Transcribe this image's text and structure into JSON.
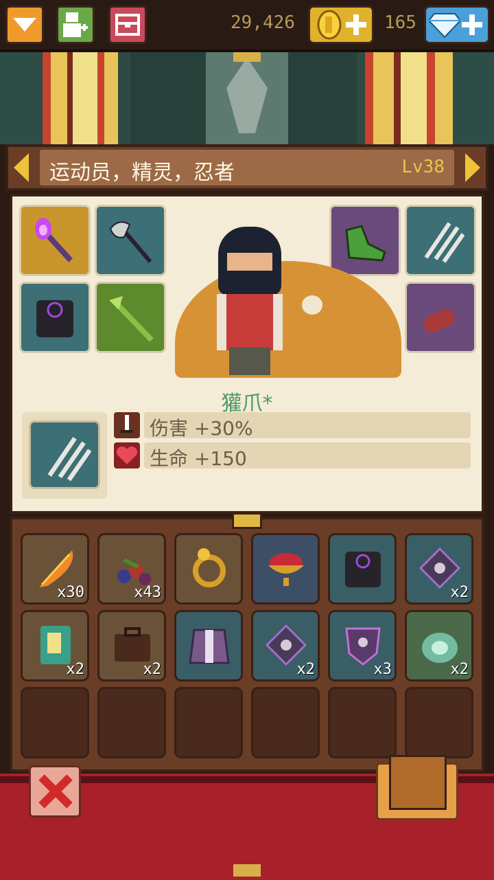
{
  "topbar": {
    "gold": "29,426",
    "gems": "165",
    "icons": [
      "dropdown-icon",
      "add-hero-icon",
      "chest-menu-icon",
      "coin-icon",
      "diamond-icon"
    ]
  },
  "character": {
    "title": "运动员，精灵，忍者",
    "level": "Lv38"
  },
  "selected_item": {
    "name": "獾爪*",
    "stats": [
      {
        "icon": "sword-icon",
        "text": "伤害  +30%",
        "color": "#6a3020"
      },
      {
        "icon": "heart-icon",
        "text": "生命  +150",
        "color": "#8a2020"
      }
    ]
  },
  "equipment": [
    {
      "name": "purple-torch-icon",
      "color": "#c8962c"
    },
    {
      "name": "battle-axe-icon",
      "color": "#3c6f76"
    },
    {
      "name": "dark-armor-icon",
      "color": "#3c6f76"
    },
    {
      "name": "bamboo-staff-icon",
      "color": "#5c8a2c"
    },
    {
      "name": "green-boots-icon",
      "color": "#6a4a7a"
    },
    {
      "name": "claw-icon",
      "color": "#3c6f76"
    },
    {
      "name": "scroll-icon",
      "color": "#6a4a7a"
    }
  ],
  "inventory": [
    {
      "icon": "feather-icon",
      "count": "x30"
    },
    {
      "icon": "berries-icon",
      "count": "x43"
    },
    {
      "icon": "gold-ring-icon",
      "count": ""
    },
    {
      "icon": "ruby-bowl-icon",
      "count": ""
    },
    {
      "icon": "dark-armor-icon",
      "count": ""
    },
    {
      "icon": "purple-shield-icon",
      "count": "x2"
    },
    {
      "icon": "green-book-icon",
      "count": "x2"
    },
    {
      "icon": "leather-bag-icon",
      "count": "x2"
    },
    {
      "icon": "purple-robe-icon",
      "count": ""
    },
    {
      "icon": "purple-shield-icon",
      "count": "x2"
    },
    {
      "icon": "crest-shield-icon",
      "count": "x3"
    },
    {
      "icon": "spirit-orb-icon",
      "count": "x2"
    }
  ]
}
